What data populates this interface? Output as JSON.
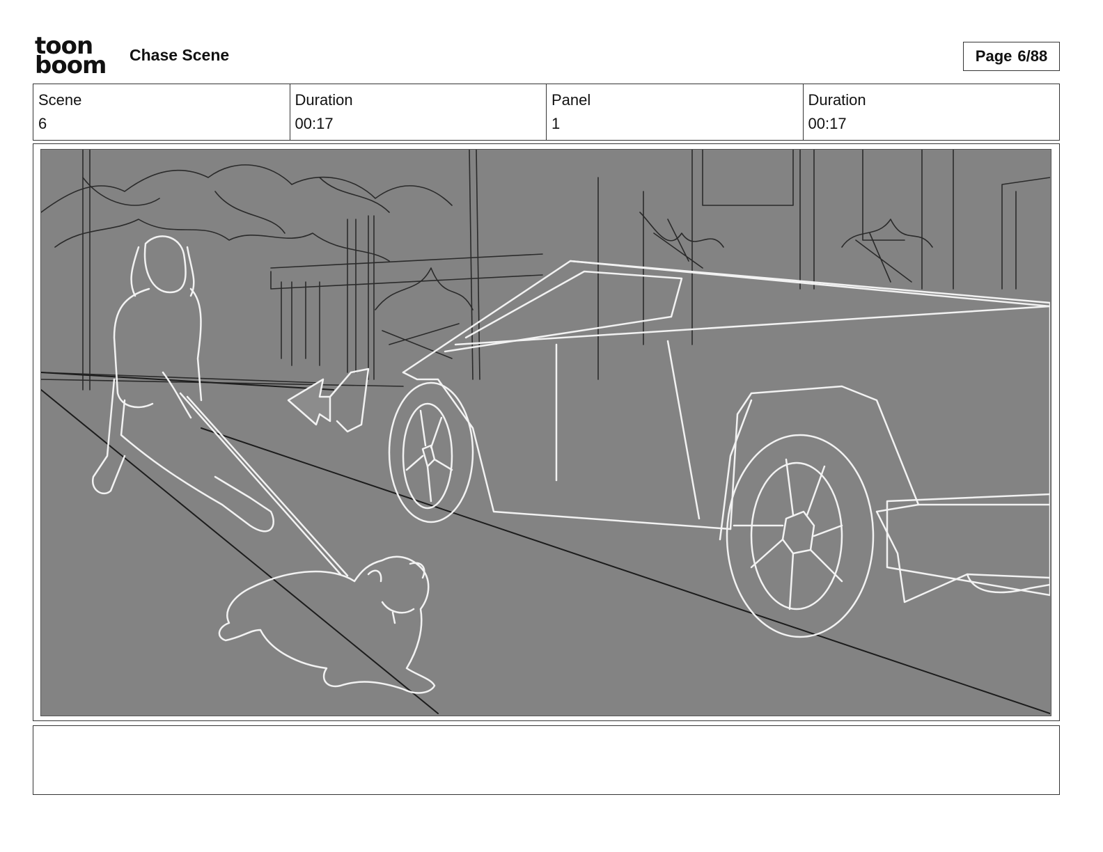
{
  "header": {
    "logo_top": "toon",
    "logo_bottom": "boom",
    "title": "Chase Scene",
    "page_label": "Page",
    "page_value": "6/88"
  },
  "info": [
    {
      "label": "Scene",
      "value": "6"
    },
    {
      "label": "Duration",
      "value": "00:17"
    },
    {
      "label": "Panel",
      "value": "1"
    },
    {
      "label": "Duration",
      "value": "00:17"
    }
  ],
  "notes": {
    "text": ""
  },
  "colors": {
    "panel_bg": "#838383",
    "sketch_line": "#f4f4f4",
    "ink": "#111111"
  }
}
